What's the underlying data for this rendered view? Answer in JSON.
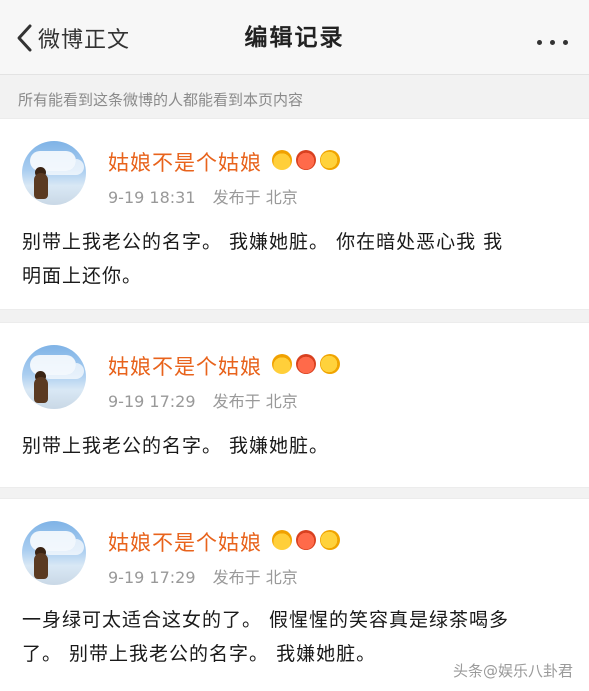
{
  "navbar": {
    "back_label": "微博正文",
    "title": "编辑记录"
  },
  "notice": "所有能看到这条微博的人都能看到本页内容",
  "records": [
    {
      "author": "姑娘不是个姑娘",
      "time": "9-19 18:31",
      "source": "发布于 北京",
      "content_lines": [
        "别带上我老公的名字。  我嫌她脏。 你在暗处恶心我  我",
        "明面上还你。"
      ]
    },
    {
      "author": "姑娘不是个姑娘",
      "time": "9-19 17:29",
      "source": "发布于 北京",
      "content_lines": [
        "别带上我老公的名字。  我嫌她脏。"
      ]
    },
    {
      "author": "姑娘不是个姑娘",
      "time": "9-19 17:29",
      "source": "发布于 北京",
      "content_lines": [
        "一身绿可太适合这女的了。 假惺惺的笑容真是绿茶喝多",
        "了。  别带上我老公的名字。 我嫌她脏。"
      ]
    }
  ],
  "badge_icons": [
    "crown-badge-icon",
    "heart-badge-icon",
    "fish-badge-icon"
  ],
  "colors": {
    "author_name": "#e8631c",
    "background": "#f2f2f2",
    "card": "#ffffff",
    "meta_text": "#999999"
  },
  "watermark": "头条@娱乐八卦君"
}
